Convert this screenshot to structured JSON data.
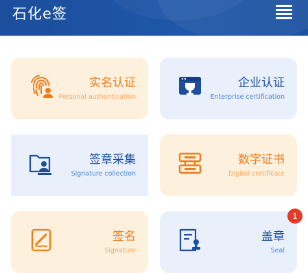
{
  "header": {
    "title": "石化e签",
    "menu_icon": "hamburger-menu-icon"
  },
  "colors": {
    "header_bg": "#1f57a8",
    "warm_card_bg": "#fdf0dc",
    "cool_card_bg": "#e9f0fc",
    "warm_accent": "#f07c1a",
    "cool_accent": "#1d4e9e",
    "badge": "#e23b2c"
  },
  "cards": [
    {
      "title": "实名认证",
      "subtitle": "Personal authentication",
      "icon": "fingerprint-user-icon"
    },
    {
      "title": "企业认证",
      "subtitle": "Enterprise certification",
      "icon": "enterprise-certificate-icon"
    },
    {
      "title": "签章采集",
      "subtitle": "Signature collection",
      "icon": "folder-user-icon"
    },
    {
      "title": "数字证书",
      "subtitle": "Digital certificate",
      "icon": "certificate-icon"
    },
    {
      "title": "签名",
      "subtitle": "Signature",
      "icon": "pen-sign-icon"
    },
    {
      "title": "盖章",
      "subtitle": "Seal",
      "icon": "document-stamp-icon"
    }
  ],
  "seal_badge": "1"
}
